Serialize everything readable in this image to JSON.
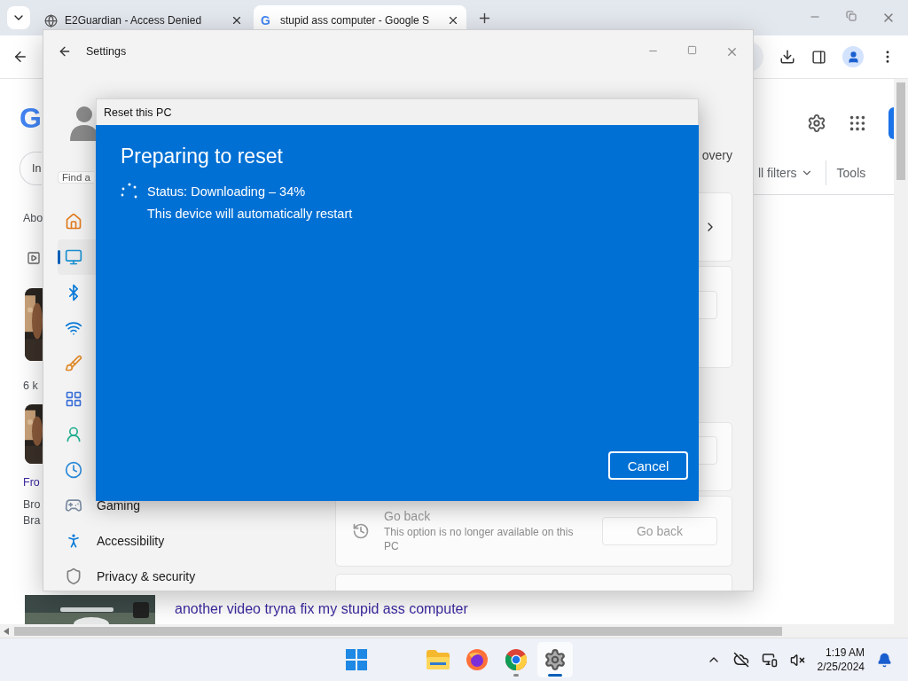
{
  "browser": {
    "tabs": [
      {
        "title": "E2Guardian - Access Denied",
        "selected": false
      },
      {
        "title": "stupid ass computer - Google S",
        "selected": true
      }
    ],
    "page": {
      "tab_icon": "G",
      "logo": "G",
      "chip": "In",
      "about": "Abo",
      "count": "6 k",
      "result_title": "Fro",
      "result_snippet": [
        "Bro",
        "Bra"
      ],
      "filters": "ll filters",
      "tools": "Tools",
      "video_title": "another video tryna fix my stupid ass computer"
    }
  },
  "settings": {
    "title": "Settings",
    "search_placeholder": "Find a",
    "header_tail": "overy",
    "nav": [
      {
        "selected": false
      },
      {
        "selected": true
      },
      {
        "selected": false
      },
      {
        "selected": false
      },
      {
        "selected": false
      },
      {
        "selected": false
      },
      {
        "selected": false
      },
      {
        "selected": false
      },
      {
        "label": "Gaming",
        "selected": false
      },
      {
        "label": "Accessibility",
        "selected": false
      },
      {
        "label": "Privacy & security",
        "selected": false
      }
    ],
    "cards": [
      {
        "kind": "link"
      },
      {
        "kind": "expander"
      },
      {
        "kind": "button"
      },
      {
        "kind": "option",
        "title": "Go back",
        "description": "This option is no longer available on this PC",
        "button": "Go back",
        "disabled": true
      },
      {
        "kind": "plain"
      }
    ]
  },
  "dialog": {
    "title": "Reset this PC",
    "heading": "Preparing to reset",
    "status": "Status: Downloading – 34%",
    "note": "This device will automatically restart",
    "cancel": "Cancel"
  },
  "taskbar": {
    "apps": [
      {
        "selected": false,
        "running": false
      },
      {
        "selected": false,
        "running": false
      },
      {
        "selected": false,
        "running": false
      },
      {
        "selected": false,
        "running": true
      },
      {
        "selected": true,
        "running": true
      }
    ],
    "time": "1:19 AM",
    "date": "2/25/2024"
  }
}
